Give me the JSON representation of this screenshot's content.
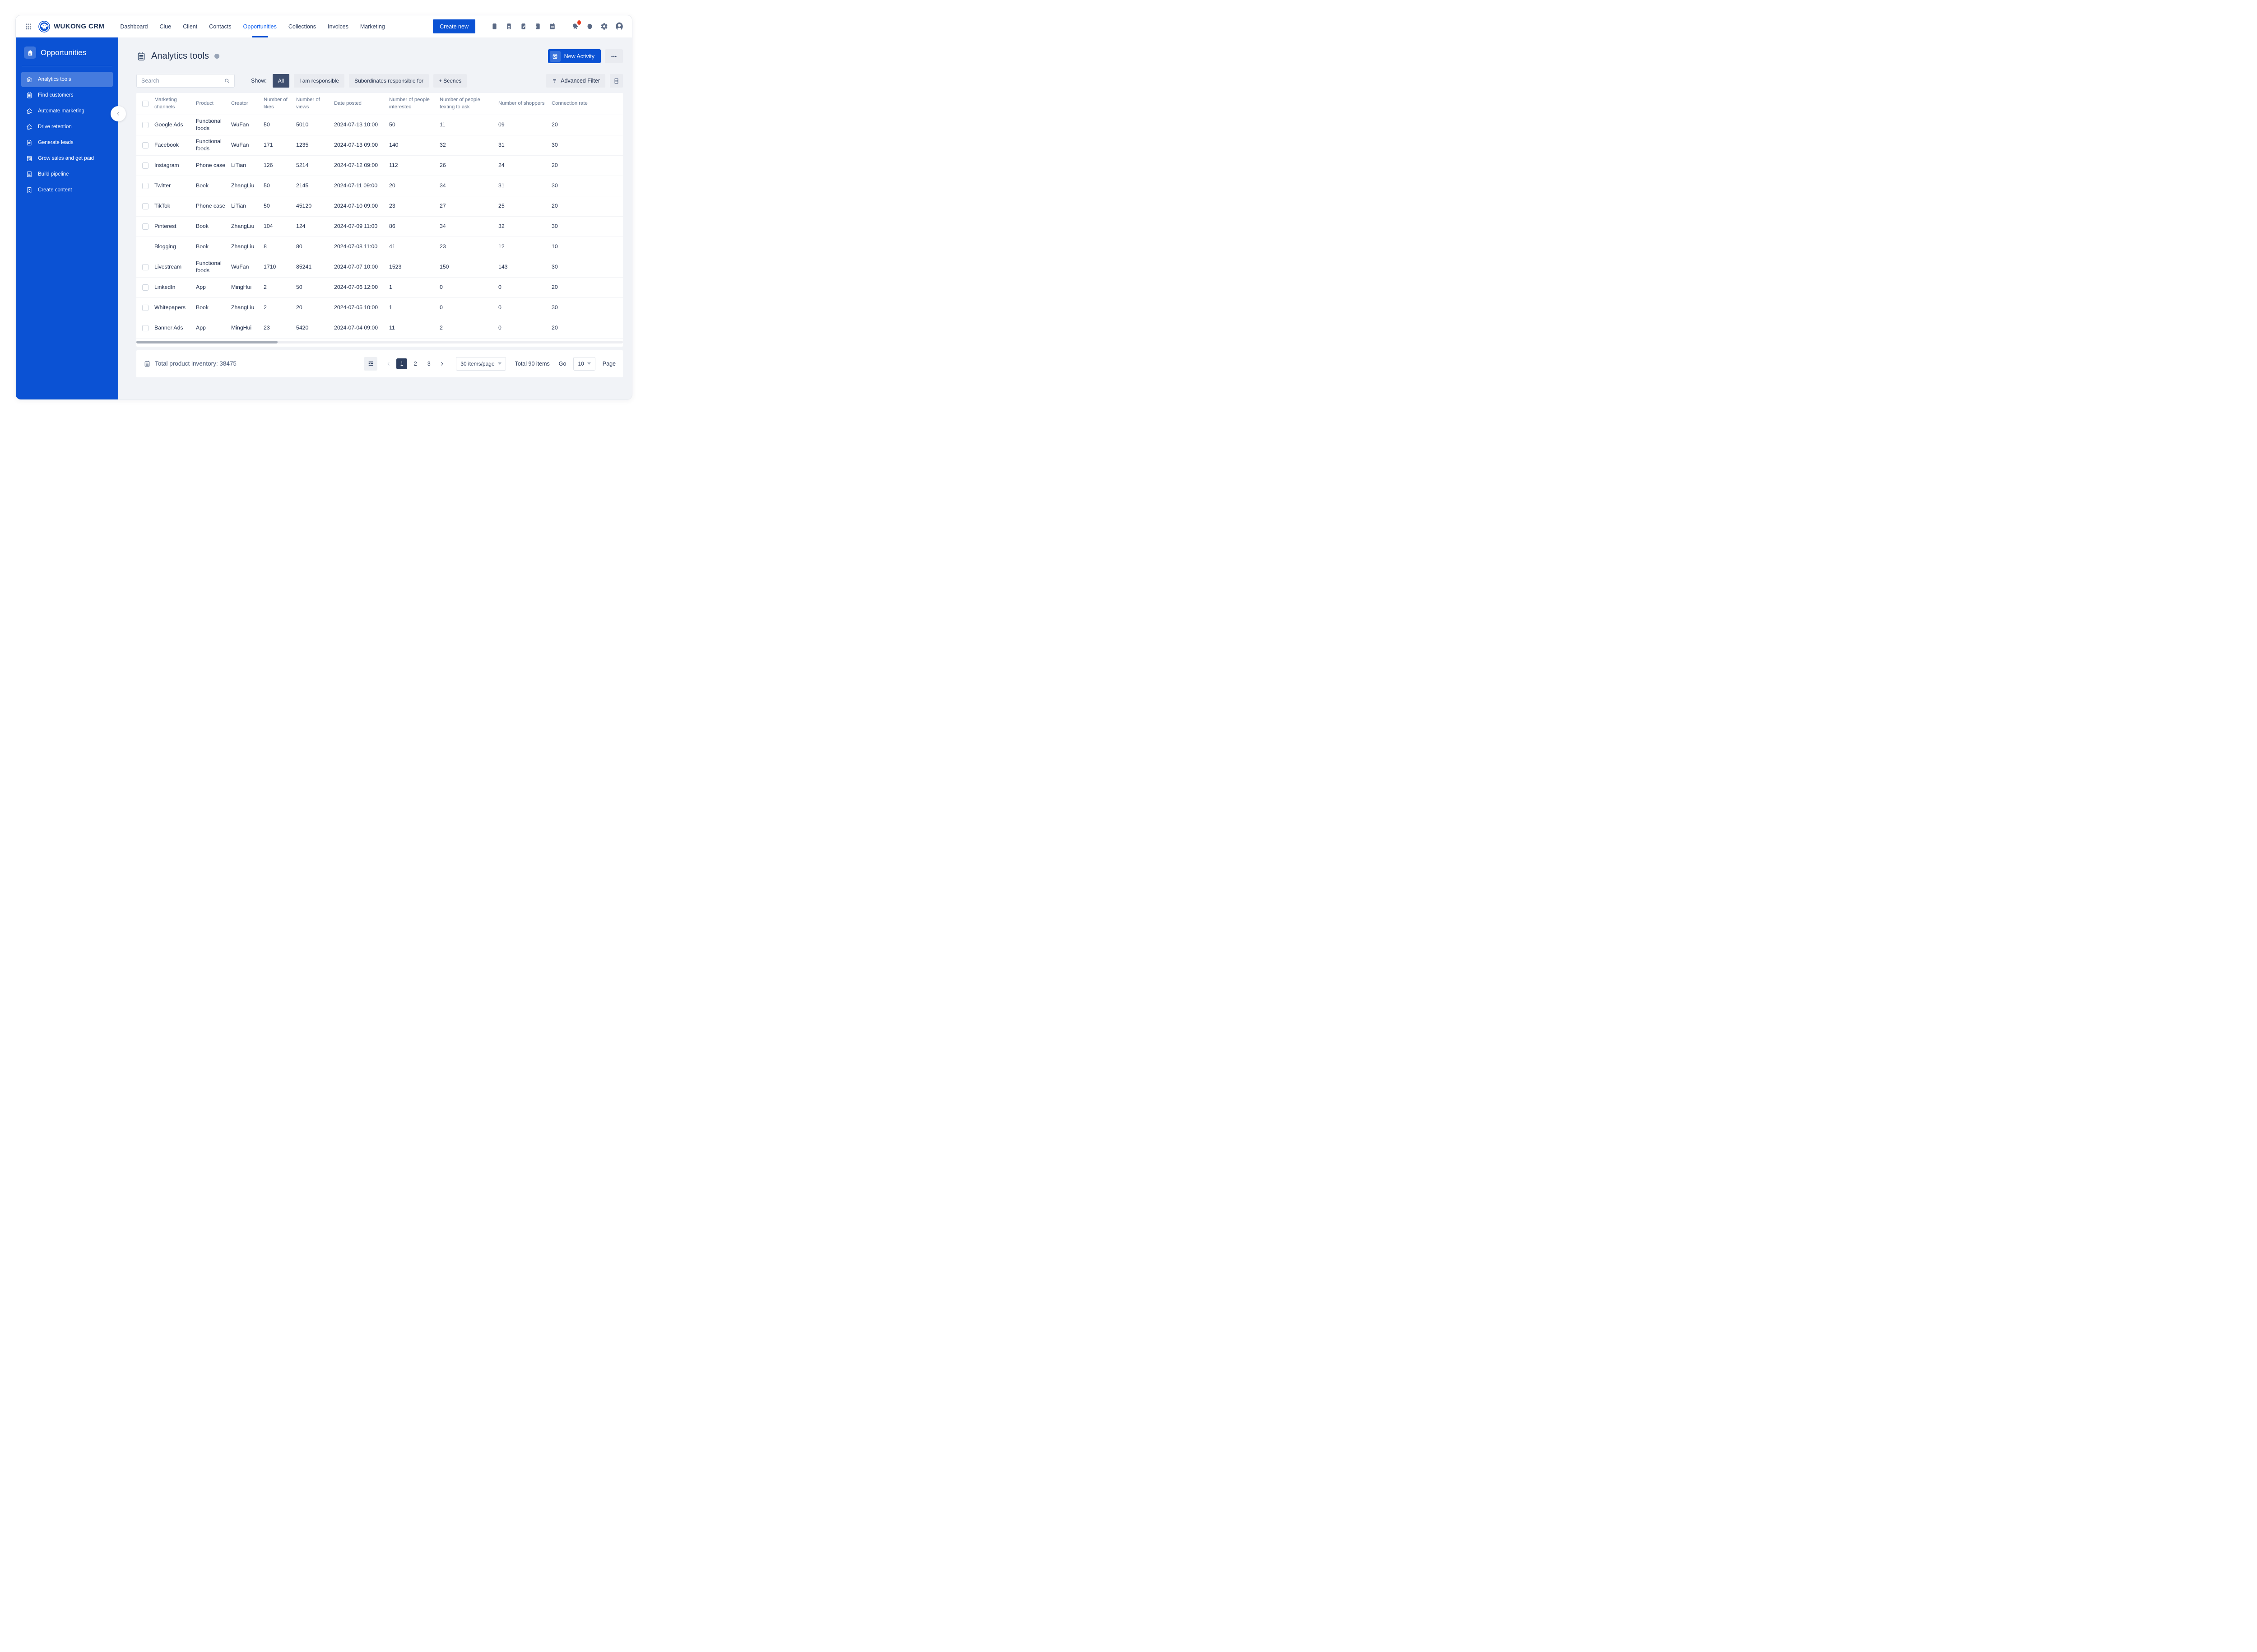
{
  "colors": {
    "accent": "#0b52d4",
    "nav_active": "#1765ef",
    "bg_content": "#f1f3f7",
    "chip_bg": "#e9ebf0",
    "dark_chip": "#3e4e6e",
    "pagination_active": "#2e3f5f",
    "notification": "#e8391d",
    "text_primary": "#22304e",
    "text_muted": "#64748f"
  },
  "topbar": {
    "brand": "WUKONG CRM",
    "nav": [
      {
        "label": "Dashboard"
      },
      {
        "label": "Clue"
      },
      {
        "label": "Client"
      },
      {
        "label": "Contacts"
      },
      {
        "label": "Opportunities",
        "active": true
      },
      {
        "label": "Collections"
      },
      {
        "label": "Invoices"
      },
      {
        "label": "Marketing"
      }
    ],
    "create_button": "Create new",
    "tool_icons": [
      "doc",
      "user-doc",
      "note",
      "list",
      "calendar"
    ],
    "account_icons": [
      {
        "icon": "bell",
        "badge": true
      },
      {
        "icon": "circle"
      },
      {
        "icon": "gear"
      },
      {
        "icon": "avatar"
      }
    ]
  },
  "sidebar": {
    "title": "Opportunities",
    "items": [
      {
        "label": "Analytics tools",
        "icon": "house-chart",
        "active": true
      },
      {
        "label": "Find customers",
        "icon": "clipboard"
      },
      {
        "label": "Automate marketing",
        "icon": "house-send"
      },
      {
        "label": "Drive retention",
        "icon": "house-send"
      },
      {
        "label": "Generate leads",
        "icon": "doc-transfer"
      },
      {
        "label": "Grow sales and get paid",
        "icon": "folder-search"
      },
      {
        "label": "Build pipeline",
        "icon": "doc-lines"
      },
      {
        "label": "Create content",
        "icon": "bookmark-x"
      }
    ]
  },
  "page": {
    "title": "Analytics tools",
    "new_activity_label": "New Activity",
    "more_label": "more",
    "search_placeholder": "Search",
    "show_label": "Show:",
    "filters": [
      {
        "label": "All",
        "active": true
      },
      {
        "label": "I am responsible"
      },
      {
        "label": "Subordinates responsible for"
      },
      {
        "label": "+ Scenes"
      }
    ],
    "advanced_filter_label": "Advanced Filter"
  },
  "table": {
    "columns": [
      "Marketing channels",
      "Product",
      "Creator",
      "Number of likes",
      "Number of views",
      "Date posted",
      "Number of people interested",
      "Number of people texting to ask",
      "Number of shoppers",
      "Connection rate"
    ],
    "rows": [
      {
        "checkbox": true,
        "cells": [
          "Google Ads",
          "Functional foods",
          "WuFan",
          "50",
          "5010",
          "2024-07-13 10:00",
          "50",
          "11",
          "09",
          "20"
        ]
      },
      {
        "checkbox": true,
        "cells": [
          "Facebook",
          "Functional foods",
          "WuFan",
          "171",
          "1235",
          "2024-07-13 09:00",
          "140",
          "32",
          "31",
          "30"
        ]
      },
      {
        "checkbox": true,
        "cells": [
          "Instagram",
          "Phone case",
          "LiTian",
          "126",
          "5214",
          "2024-07-12 09:00",
          "112",
          "26",
          "24",
          "20"
        ]
      },
      {
        "checkbox": true,
        "cells": [
          "Twitter",
          "Book",
          "ZhangLiu",
          "50",
          "2145",
          "2024-07-11 09:00",
          "20",
          "34",
          "31",
          "30"
        ]
      },
      {
        "checkbox": true,
        "cells": [
          "TikTok",
          "Phone case",
          "LiTian",
          "50",
          "45120",
          "2024-07-10 09:00",
          "23",
          "27",
          "25",
          "20"
        ]
      },
      {
        "checkbox": true,
        "cells": [
          "Pinterest",
          "Book",
          "ZhangLiu",
          "104",
          "124",
          "2024-07-09 11:00",
          "86",
          "34",
          "32",
          "30"
        ]
      },
      {
        "checkbox": false,
        "cells": [
          "Blogging",
          "Book",
          "ZhangLiu",
          "8",
          "80",
          "2024-07-08 11:00",
          "41",
          "23",
          "12",
          "10"
        ]
      },
      {
        "checkbox": true,
        "cells": [
          "Livestream",
          "Functional foods",
          "WuFan",
          "1710",
          "85241",
          "2024-07-07 10:00",
          "1523",
          "150",
          "143",
          "30"
        ]
      },
      {
        "checkbox": true,
        "cells": [
          "LinkedIn",
          "App",
          "MingHui",
          "2",
          "50",
          "2024-07-06 12:00",
          "1",
          "0",
          "0",
          "20"
        ]
      },
      {
        "checkbox": true,
        "cells": [
          "Whitepapers",
          "Book",
          "ZhangLiu",
          "2",
          "20",
          "2024-07-05 10:00",
          "1",
          "0",
          "0",
          "30"
        ]
      },
      {
        "checkbox": true,
        "cells": [
          "Banner Ads",
          "App",
          "MingHui",
          "23",
          "5420",
          "2024-07-04 09:00",
          "11",
          "2",
          "0",
          "20"
        ]
      }
    ]
  },
  "footer": {
    "total_inventory": "Total product inventory: 38475",
    "pages": [
      "1",
      "2",
      "3"
    ],
    "active_page": "1",
    "page_size": "30 items/page",
    "total_items": "Total 90 items",
    "go_label": "Go",
    "go_value": "10",
    "page_label": "Page"
  }
}
